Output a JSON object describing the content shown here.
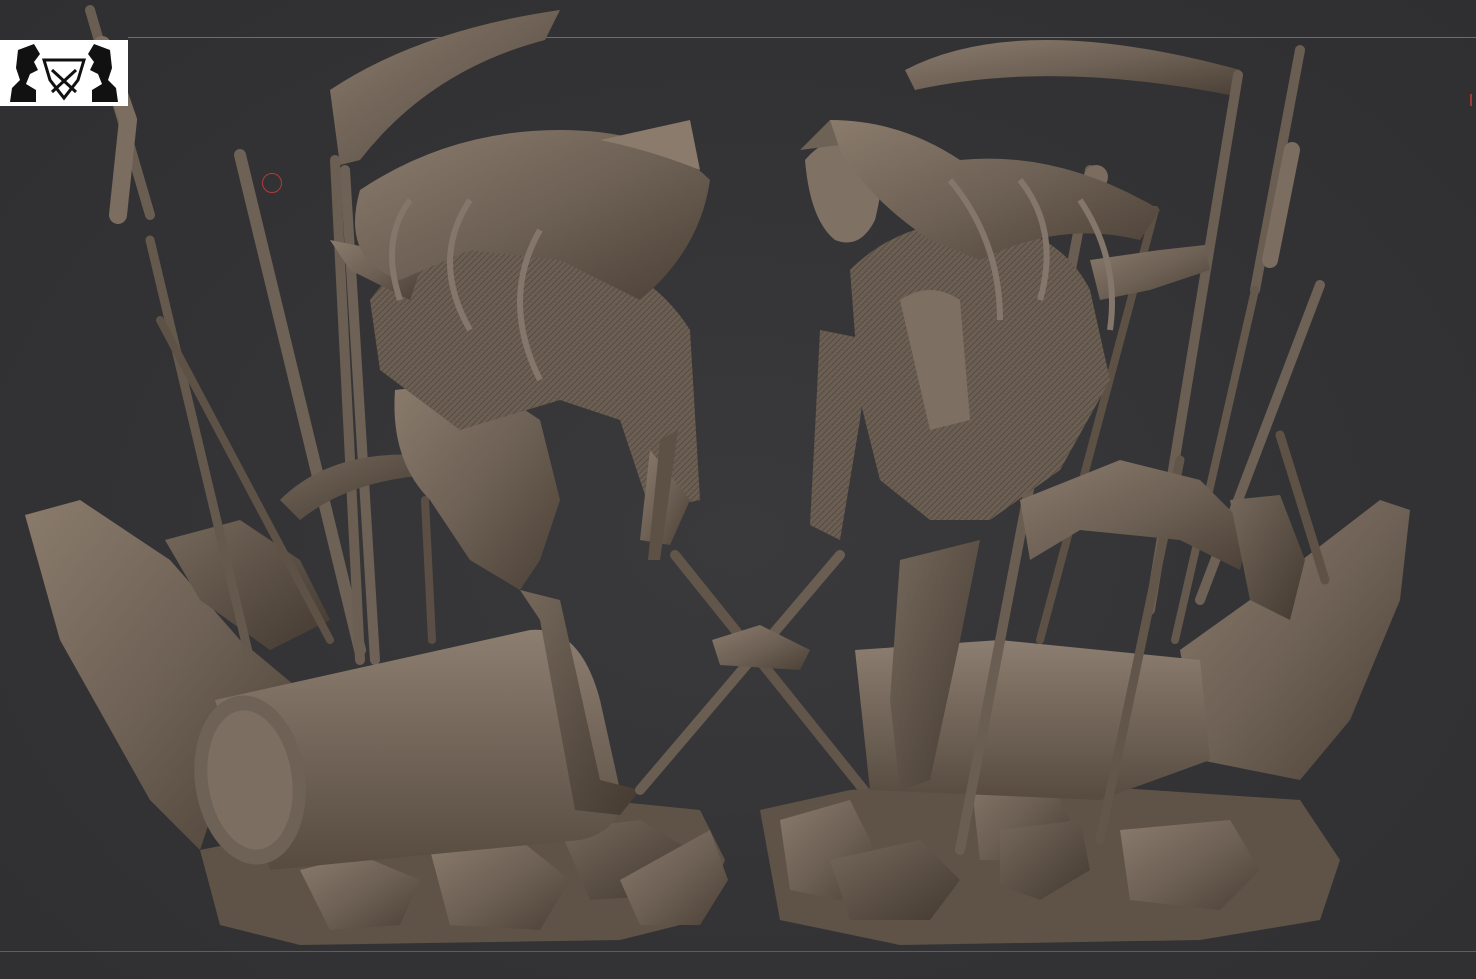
{
  "viewport": {
    "background": "#333335",
    "clay_color": "#6e6155",
    "clay_shadow": "#4a3f36",
    "clay_highlight": "#8f8172"
  },
  "overlay": {
    "logo": "brand-logo-icon",
    "brush_cursor": "brush-cursor-icon",
    "brush_cursor_color": "#b23a3a"
  },
  "models": [
    {
      "name": "figure-back-view",
      "view": "back"
    },
    {
      "name": "figure-front-view",
      "view": "front"
    }
  ]
}
